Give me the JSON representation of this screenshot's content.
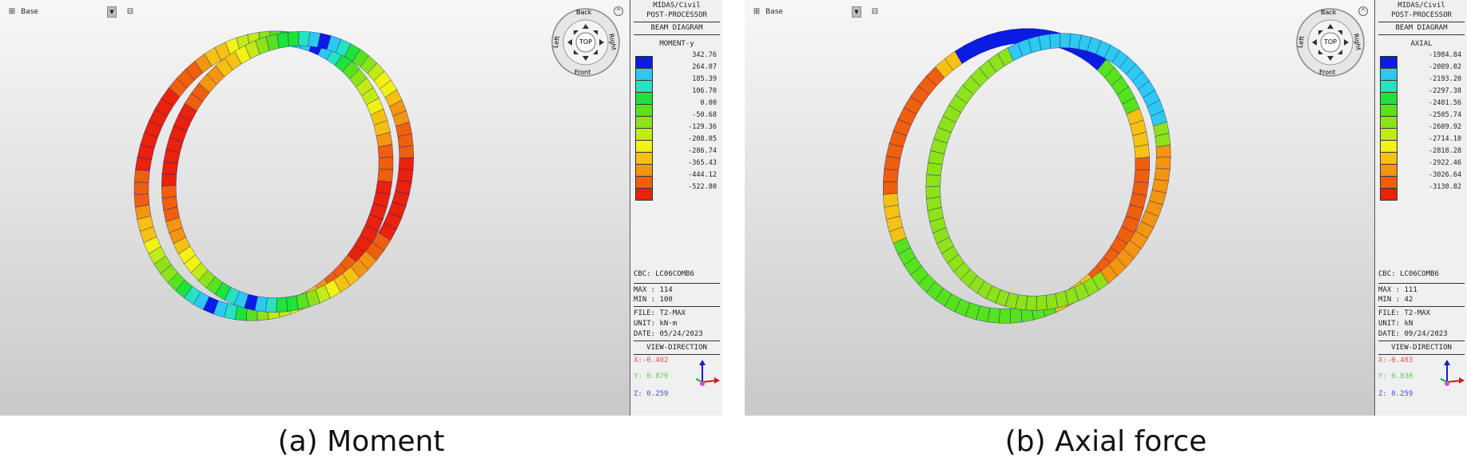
{
  "panels": [
    {
      "toolbar": {
        "base_label": "Base"
      },
      "navcube": {
        "back": "Back",
        "front": "Front",
        "left": "Left",
        "right": "Right",
        "top": "TOP"
      },
      "sidebar": {
        "title1": "MIDAS/Civil",
        "title2": "POST-PROCESSOR",
        "title3": "BEAM DIAGRAM",
        "diagram": "MOMENT-y",
        "legend": [
          {
            "label": "342.76",
            "color": "#0a1be6"
          },
          {
            "label": "264.07",
            "color": "#2ec8f0"
          },
          {
            "label": "185.39",
            "color": "#27e2c0"
          },
          {
            "label": "106.70",
            "color": "#1fe23a"
          },
          {
            "label": "0.00",
            "color": "#57e21e"
          },
          {
            "label": "-50.68",
            "color": "#8ee21a"
          },
          {
            "label": "-129.36",
            "color": "#c2ea16"
          },
          {
            "label": "-208.05",
            "color": "#f2f214"
          },
          {
            "label": "-286.74",
            "color": "#f5c211"
          },
          {
            "label": "-365.43",
            "color": "#f29510"
          },
          {
            "label": "-444.12",
            "color": "#ee5f0e"
          },
          {
            "label": "-522.80",
            "color": "#e8220c"
          }
        ],
        "cbc": "CBC: LC06COMB6",
        "max": "MAX : 114",
        "min": "MIN : 100",
        "file": "FILE: T2-MAX",
        "unit": "UNIT: kN·m",
        "date": "DATE: 05/24/2023",
        "view_direction": "VIEW-DIRECTION",
        "x": "X:-0.402",
        "y": "Y: 0.879",
        "z": "Z: 0.259"
      },
      "caption": "(a) Moment"
    },
    {
      "toolbar": {
        "base_label": "Base"
      },
      "navcube": {
        "back": "Back",
        "front": "Front",
        "left": "Left",
        "right": "Right",
        "top": "TOP"
      },
      "sidebar": {
        "title1": "MIDAS/Civil",
        "title2": "POST-PROCESSOR",
        "title3": "BEAM DIAGRAM",
        "diagram": "AXIAL",
        "legend": [
          {
            "label": "-1984.84",
            "color": "#0a1be6"
          },
          {
            "label": "-2089.02",
            "color": "#2ec8f0"
          },
          {
            "label": "-2193.20",
            "color": "#27e2c0"
          },
          {
            "label": "-2297.38",
            "color": "#1fe23a"
          },
          {
            "label": "-2401.56",
            "color": "#57e21e"
          },
          {
            "label": "-2505.74",
            "color": "#8ee21a"
          },
          {
            "label": "-2609.92",
            "color": "#c2ea16"
          },
          {
            "label": "-2714.10",
            "color": "#f2f214"
          },
          {
            "label": "-2818.28",
            "color": "#f5c211"
          },
          {
            "label": "-2922.46",
            "color": "#f29510"
          },
          {
            "label": "-3026.64",
            "color": "#ee5f0e"
          },
          {
            "label": "-3130.82",
            "color": "#e8220c"
          }
        ],
        "cbc": "CBC: LC06COMB6",
        "max": "MAX : 111",
        "min": "MIN : 42",
        "file": "FILE: T2-MAX",
        "unit": "UNIT: kN",
        "date": "DATE: 09/24/2023",
        "view_direction": "VIEW-DIRECTION",
        "x": "X:-0.483",
        "y": "Y: 0.838",
        "z": "Z: 0.259"
      },
      "caption": "(b) Axial force"
    }
  ]
}
